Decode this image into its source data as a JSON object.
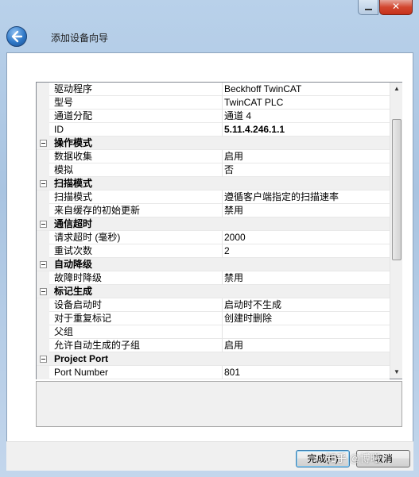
{
  "window": {
    "title": "",
    "close_glyph": "✕",
    "header_title": "添加设备向导"
  },
  "grid": {
    "rows": [
      {
        "type": "prop",
        "name": "驱动程序",
        "value": "Beckhoff TwinCAT"
      },
      {
        "type": "prop",
        "name": "型号",
        "value": "TwinCAT PLC"
      },
      {
        "type": "prop",
        "name": "通道分配",
        "value": "通道 4"
      },
      {
        "type": "prop",
        "name": "ID",
        "value": "5.11.4.246.1.1",
        "bold": true
      },
      {
        "type": "cat",
        "name": "操作模式"
      },
      {
        "type": "prop",
        "name": "数据收集",
        "value": "启用"
      },
      {
        "type": "prop",
        "name": "模拟",
        "value": "否"
      },
      {
        "type": "cat",
        "name": "扫描模式"
      },
      {
        "type": "prop",
        "name": "扫描模式",
        "value": "遵循客户端指定的扫描速率"
      },
      {
        "type": "prop",
        "name": "来自缓存的初始更新",
        "value": "禁用"
      },
      {
        "type": "cat",
        "name": "通信超时"
      },
      {
        "type": "prop",
        "name": "请求超时 (毫秒)",
        "value": "2000"
      },
      {
        "type": "prop",
        "name": "重试次数",
        "value": "2"
      },
      {
        "type": "cat",
        "name": "自动降级"
      },
      {
        "type": "prop",
        "name": "故障时降级",
        "value": "禁用"
      },
      {
        "type": "cat",
        "name": "标记生成"
      },
      {
        "type": "prop",
        "name": "设备启动时",
        "value": "启动时不生成"
      },
      {
        "type": "prop",
        "name": "对于重复标记",
        "value": "创建时删除"
      },
      {
        "type": "prop",
        "name": "父组",
        "value": ""
      },
      {
        "type": "prop",
        "name": "允许自动生成的子组",
        "value": "启用"
      },
      {
        "type": "cat",
        "name": "Project Port"
      },
      {
        "type": "prop",
        "name": "Port Number",
        "value": "801"
      }
    ]
  },
  "scrollbar": {
    "up_glyph": "▲",
    "down_glyph": "▼"
  },
  "buttons": {
    "finish_label": "完成(F)",
    "cancel_label": "取消"
  },
  "watermark": "知乎 @博曦",
  "colors": {
    "accent": "#3c7fb1",
    "frame": "#b9d1ea",
    "close": "#c6311b"
  }
}
